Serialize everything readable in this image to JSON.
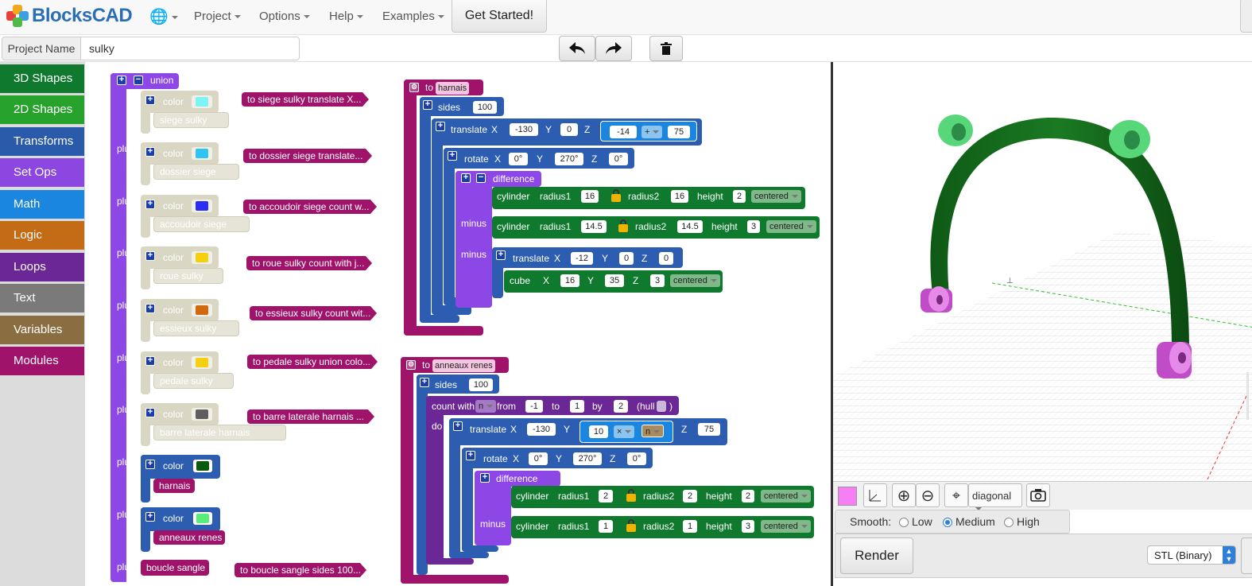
{
  "app": {
    "name": "BlocksCAD",
    "nav": [
      "Project",
      "Options",
      "Help",
      "Examples"
    ],
    "get_started": "Get Started!"
  },
  "project": {
    "label": "Project Name",
    "value": "sulky"
  },
  "categories": [
    {
      "label": "3D Shapes",
      "color": "#0f7a2e"
    },
    {
      "label": "2D Shapes",
      "color": "#27a32d"
    },
    {
      "label": "Transforms",
      "color": "#2a5baa"
    },
    {
      "label": "Set Ops",
      "color": "#8b47e0"
    },
    {
      "label": "Math",
      "color": "#1a86e0"
    },
    {
      "label": "Logic",
      "color": "#c46b16"
    },
    {
      "label": "Loops",
      "color": "#6b2796"
    },
    {
      "label": "Text",
      "color": "#7a7a7a"
    },
    {
      "label": "Variables",
      "color": "#8a6e42"
    },
    {
      "label": "Modules",
      "color": "#a0136a"
    }
  ],
  "union_block": {
    "label": "union",
    "plus": "plus",
    "color_label": "color",
    "items": [
      {
        "module": "siege sulky",
        "swatch": "#7ff4f4",
        "enabled": false
      },
      {
        "module": "dossier siege",
        "swatch": "#2ec5f5",
        "enabled": false
      },
      {
        "module": "accoudoir siege",
        "swatch": "#2d2ff0",
        "enabled": false
      },
      {
        "module": "roue sulky",
        "swatch": "#f5cf12",
        "enabled": false
      },
      {
        "module": "essieux sulky",
        "swatch": "#d2690f",
        "enabled": false
      },
      {
        "module": "pedale sulky",
        "swatch": "#f5cf12",
        "enabled": false
      },
      {
        "module": "barre laterale harnais",
        "swatch": "#5e5e5e",
        "enabled": false
      },
      {
        "module": "harnais",
        "swatch": "#0b5a10",
        "enabled": true
      },
      {
        "module": "anneaux renes",
        "swatch": "#59ee7a",
        "enabled": true
      }
    ],
    "last_module": "boucle sangle"
  },
  "definitions": [
    "to siege sulky  translate X...",
    "to dossier siege  translate...",
    "to accoudoir siege  count w...",
    "to roue sulky  count with j...",
    "to essieux sulky  count wit...",
    "to pedale sulky  union colo...",
    "to barre laterale harnais  ...",
    "to boucle sangle  sides 100..."
  ],
  "harnais": {
    "to": "to",
    "name": "harnais",
    "sides_label": "sides",
    "sides": "100",
    "translate": {
      "label": "translate",
      "x": "-130",
      "y": "0",
      "z_a": "-14",
      "op": "+",
      "z_b": "75"
    },
    "rotate": {
      "label": "rotate",
      "x": "0°",
      "y": "270°",
      "z": "0°"
    },
    "difference": "difference",
    "minus": "minus",
    "cyl1": {
      "label": "cylinder",
      "r1_label": "radius1",
      "r1": "16",
      "r2_label": "radius2",
      "r2": "16",
      "h_label": "height",
      "h": "2",
      "mode": "centered"
    },
    "cyl2": {
      "label": "cylinder",
      "r1_label": "radius1",
      "r1": "14.5",
      "r2_label": "radius2",
      "r2": "14.5",
      "h_label": "height",
      "h": "3",
      "mode": "centered"
    },
    "translate2": {
      "label": "translate",
      "x": "-12",
      "y": "0",
      "z": "0"
    },
    "cube": {
      "label": "cube",
      "x": "16",
      "y": "35",
      "z": "3",
      "mode": "centered"
    }
  },
  "anneaux": {
    "to": "to",
    "name": "anneaux renes",
    "sides_label": "sides",
    "sides": "100",
    "count": {
      "label": "count with",
      "var": "n",
      "from_label": "from",
      "from": "-1",
      "to_label": "to",
      "to": "1",
      "by_label": "by",
      "by": "2",
      "hull_label": "(hull",
      "close": ")"
    },
    "do": "do",
    "translate": {
      "label": "translate",
      "x": "-130",
      "y_a": "10",
      "op": "×",
      "y_b": "n",
      "z": "75"
    },
    "rotate": {
      "label": "rotate",
      "x": "0°",
      "y": "270°",
      "z": "0°"
    },
    "difference": "difference",
    "minus": "minus",
    "cyl1": {
      "label": "cylinder",
      "r1_label": "radius1",
      "r1": "2",
      "r2_label": "radius2",
      "r2": "2",
      "h_label": "height",
      "h": "2",
      "mode": "centered"
    },
    "cyl2": {
      "label": "cylinder",
      "r1_label": "radius1",
      "r1": "1",
      "r2_label": "radius2",
      "r2": "1",
      "h_label": "height",
      "h": "3",
      "mode": "centered"
    }
  },
  "axis_labels": {
    "x": "X",
    "y": "Y",
    "z": "Z"
  },
  "viewer": {
    "swatch": "#f77ef5",
    "view": "diagonal",
    "smooth_label": "Smooth:",
    "smooth_options": [
      "Low",
      "Medium",
      "High"
    ],
    "smooth_selected": "Medium",
    "render": "Render",
    "export": "STL (Binary)"
  }
}
